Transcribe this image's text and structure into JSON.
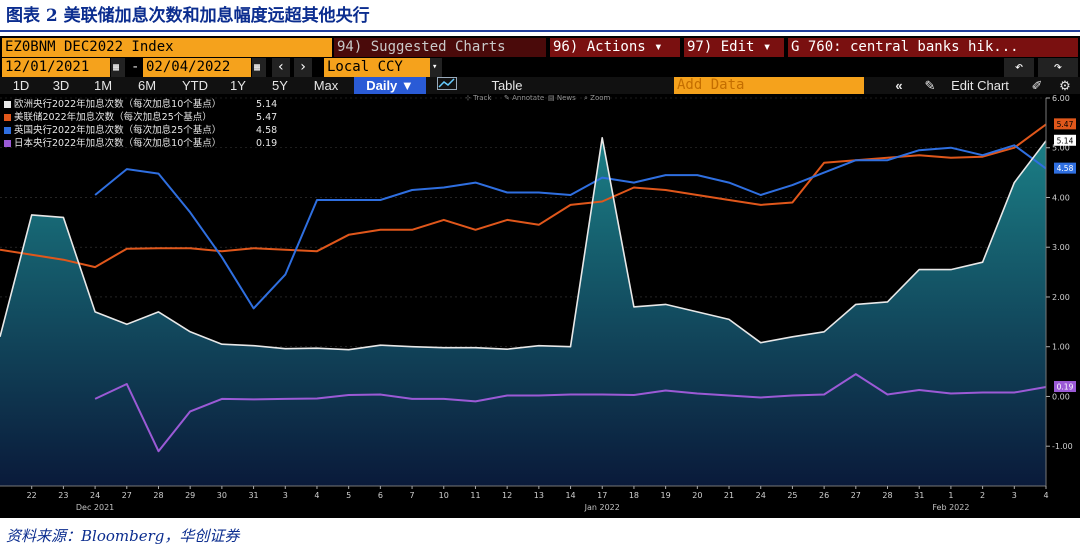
{
  "caption": "图表 2 美联储加息次数和加息幅度远超其他央行",
  "source": "资料来源：Bloomberg，华创证券",
  "terminal": {
    "ticker": "EZ0BNM DEC2022 Index",
    "suggested": "94) Suggested Charts",
    "actions": "96) Actions ▾",
    "edit": "97) Edit ▾",
    "chart_title": "G 760: central banks hik...",
    "date_from": "12/01/2021",
    "date_sep": "-",
    "date_to": "02/04/2022",
    "currency": "Local CCY",
    "periods": [
      "1D",
      "3D",
      "1M",
      "6M",
      "YTD",
      "1Y",
      "5Y",
      "Max"
    ],
    "frequency": "Daily ▼",
    "table_label": "Table",
    "add_data": "Add Data",
    "edit_chart": "Edit Chart",
    "tools": [
      "Track",
      "Annotate",
      "News",
      "Zoom"
    ]
  },
  "colors": {
    "ecb": "#e8e8e8",
    "fed": "#e0571b",
    "boe": "#2f6fe0",
    "boj": "#9b5ad6",
    "fill_top": "#1b7f86",
    "fill_bottom": "#0a1a3a"
  },
  "chart_data": {
    "type": "line",
    "title": "",
    "xlabel": "",
    "ylabel": "",
    "ylim": [
      -1.8,
      6.0
    ],
    "yticks": [
      "-1.00",
      "0.00",
      "1.00",
      "2.00",
      "3.00",
      "4.00",
      "5.00",
      "6.00"
    ],
    "x_ticks": [
      "22",
      "23",
      "24",
      "27",
      "28",
      "29",
      "30",
      "31",
      "3",
      "4",
      "5",
      "6",
      "7",
      "10",
      "11",
      "12",
      "13",
      "14",
      "17",
      "18",
      "19",
      "20",
      "21",
      "24",
      "25",
      "26",
      "27",
      "28",
      "31",
      "1",
      "2",
      "3",
      "4"
    ],
    "month_labels": [
      "Dec 2021",
      "Jan 2022",
      "Feb 2022"
    ],
    "x": [
      "21",
      "22",
      "23",
      "24",
      "27",
      "28",
      "29",
      "30",
      "31",
      "3",
      "4",
      "5",
      "6",
      "7",
      "10",
      "11",
      "12",
      "13",
      "14",
      "17",
      "18",
      "19",
      "20",
      "21",
      "24",
      "25",
      "26",
      "27",
      "28",
      "31",
      "1",
      "2",
      "3",
      "4"
    ],
    "series": [
      {
        "name": "欧洲央行2022年加息次数（每次加息10个基点）",
        "last": "5.14",
        "values": [
          1.2,
          3.65,
          3.6,
          1.7,
          1.45,
          1.7,
          1.3,
          1.05,
          1.02,
          0.96,
          0.97,
          0.94,
          1.03,
          1.0,
          0.98,
          0.98,
          0.95,
          1.02,
          1.0,
          5.2,
          1.8,
          1.85,
          1.7,
          1.55,
          1.08,
          1.2,
          1.3,
          1.85,
          1.9,
          2.55,
          2.55,
          2.7,
          4.3,
          5.14
        ]
      },
      {
        "name": "美联储2022年加息次数（每次加息25个基点）",
        "last": "5.47",
        "values": [
          2.95,
          2.85,
          2.75,
          2.6,
          2.97,
          2.98,
          2.98,
          2.92,
          2.98,
          2.95,
          2.92,
          3.25,
          3.35,
          3.35,
          3.55,
          3.35,
          3.55,
          3.45,
          3.85,
          3.92,
          4.2,
          4.15,
          4.05,
          3.95,
          3.85,
          3.9,
          4.7,
          4.75,
          4.8,
          4.85,
          4.8,
          4.82,
          5.0,
          5.47
        ]
      },
      {
        "name": "英国央行2022年加息次数（每次加息25个基点）",
        "last": "4.58",
        "values": [
          null,
          null,
          null,
          4.05,
          4.57,
          4.48,
          3.7,
          2.8,
          1.77,
          2.45,
          3.95,
          3.95,
          3.95,
          4.15,
          4.2,
          4.3,
          4.1,
          4.1,
          4.05,
          4.4,
          4.3,
          4.45,
          4.45,
          4.3,
          4.05,
          4.25,
          4.5,
          4.75,
          4.75,
          4.95,
          5.0,
          4.85,
          5.05,
          4.58
        ]
      },
      {
        "name": "日本央行2022年加息次数（每次加息10个基点）",
        "last": "0.19",
        "values": [
          null,
          null,
          null,
          -0.05,
          0.25,
          -1.1,
          -0.3,
          -0.05,
          -0.06,
          -0.05,
          -0.04,
          0.03,
          0.04,
          -0.05,
          -0.05,
          -0.1,
          0.02,
          0.02,
          0.04,
          0.04,
          0.03,
          0.12,
          0.06,
          0.02,
          -0.02,
          0.02,
          0.04,
          0.45,
          0.04,
          0.13,
          0.06,
          0.08,
          0.08,
          0.19
        ]
      }
    ]
  }
}
